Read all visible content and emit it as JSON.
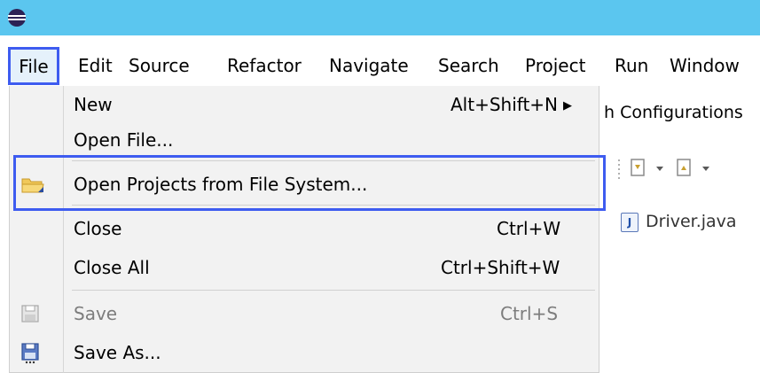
{
  "menubar": {
    "items": [
      "File",
      "Edit",
      "Source",
      "Refactor",
      "Navigate",
      "Search",
      "Project",
      "Run",
      "Window"
    ]
  },
  "background": {
    "launch_config_text": "h Configurations",
    "tab_label": "Driver.java",
    "java_icon_letter": "J"
  },
  "file_menu": {
    "items": [
      {
        "label": "New",
        "shortcut": "Alt+Shift+N",
        "submenu": true,
        "icon": "none",
        "enabled": true
      },
      {
        "label": "Open File...",
        "shortcut": "",
        "icon": "none",
        "enabled": true
      },
      {
        "label": "Open Projects from File System...",
        "shortcut": "",
        "icon": "folder-icon",
        "enabled": true,
        "highlighted": true
      },
      {
        "label": "Close",
        "shortcut": "Ctrl+W",
        "icon": "none",
        "enabled": true
      },
      {
        "label": "Close All",
        "shortcut": "Ctrl+Shift+W",
        "icon": "none",
        "enabled": true
      },
      {
        "label": "Save",
        "shortcut": "Ctrl+S",
        "icon": "save-icon",
        "enabled": false
      },
      {
        "label": "Save As...",
        "shortcut": "",
        "icon": "save-as-icon",
        "enabled": true
      }
    ]
  },
  "colors": {
    "titlebar": "#5bc6ef",
    "highlight_border": "#3e5cf0",
    "menu_bg": "#f2f2f2"
  }
}
